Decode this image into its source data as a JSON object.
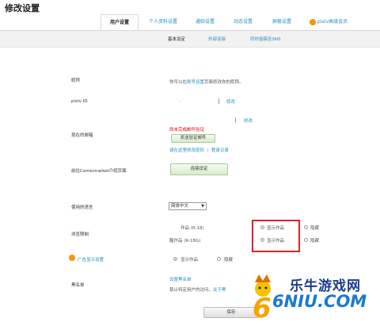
{
  "page_title": "修改设置",
  "tabs": [
    {
      "label": "用户设置",
      "active": true
    },
    {
      "label": "个人资料设置"
    },
    {
      "label": "通知设置"
    },
    {
      "label": "动态设置"
    },
    {
      "label": "屏蔽设置"
    },
    {
      "label": "pixiv高级会员",
      "icon": "pixiv-icon"
    }
  ],
  "subtabs": [
    {
      "label": "基本设定",
      "active": true
    },
    {
      "label": "外部连接"
    },
    {
      "label": "同时投稿至SNS"
    }
  ],
  "nickname": {
    "label": "昵称",
    "text_before": "你可以在",
    "link": "账号设置",
    "text_after": "页面修改你的昵称。"
  },
  "pixiv_id": {
    "label": "pixiv ID",
    "change_link": "修改"
  },
  "email": {
    "label": "现在的邮箱",
    "change_link": "修改",
    "warning": "尚未完成邮件验证",
    "send_button": "发送验证邮件",
    "reset_link": "请在这里修改密码",
    "login_history_link": "登录记录"
  },
  "comicmarket": {
    "label": "前往Comicmarket介绍页面",
    "button": "连接设定"
  },
  "language": {
    "label": "使用的语言",
    "selected": "简体中文"
  },
  "browsing": {
    "label": "浏览限制",
    "row1_text": "作品 (R-18)",
    "row2_text": "腥作品 (R-18G)",
    "show_label": "显示作品",
    "hide_label": "隐藏"
  },
  "ads": {
    "label": "广告显示设置",
    "show_label": "显示作品",
    "hide_label": "隐藏"
  },
  "blacklist": {
    "label": "黑名单",
    "link": "设置黑名单",
    "desc_before": "禁止特定用户的访问。",
    "desc_link": "关于黑"
  },
  "save_button": "保存",
  "watermark": {
    "text": "乐牛游戏网",
    "logo": "6NIU.COM"
  }
}
